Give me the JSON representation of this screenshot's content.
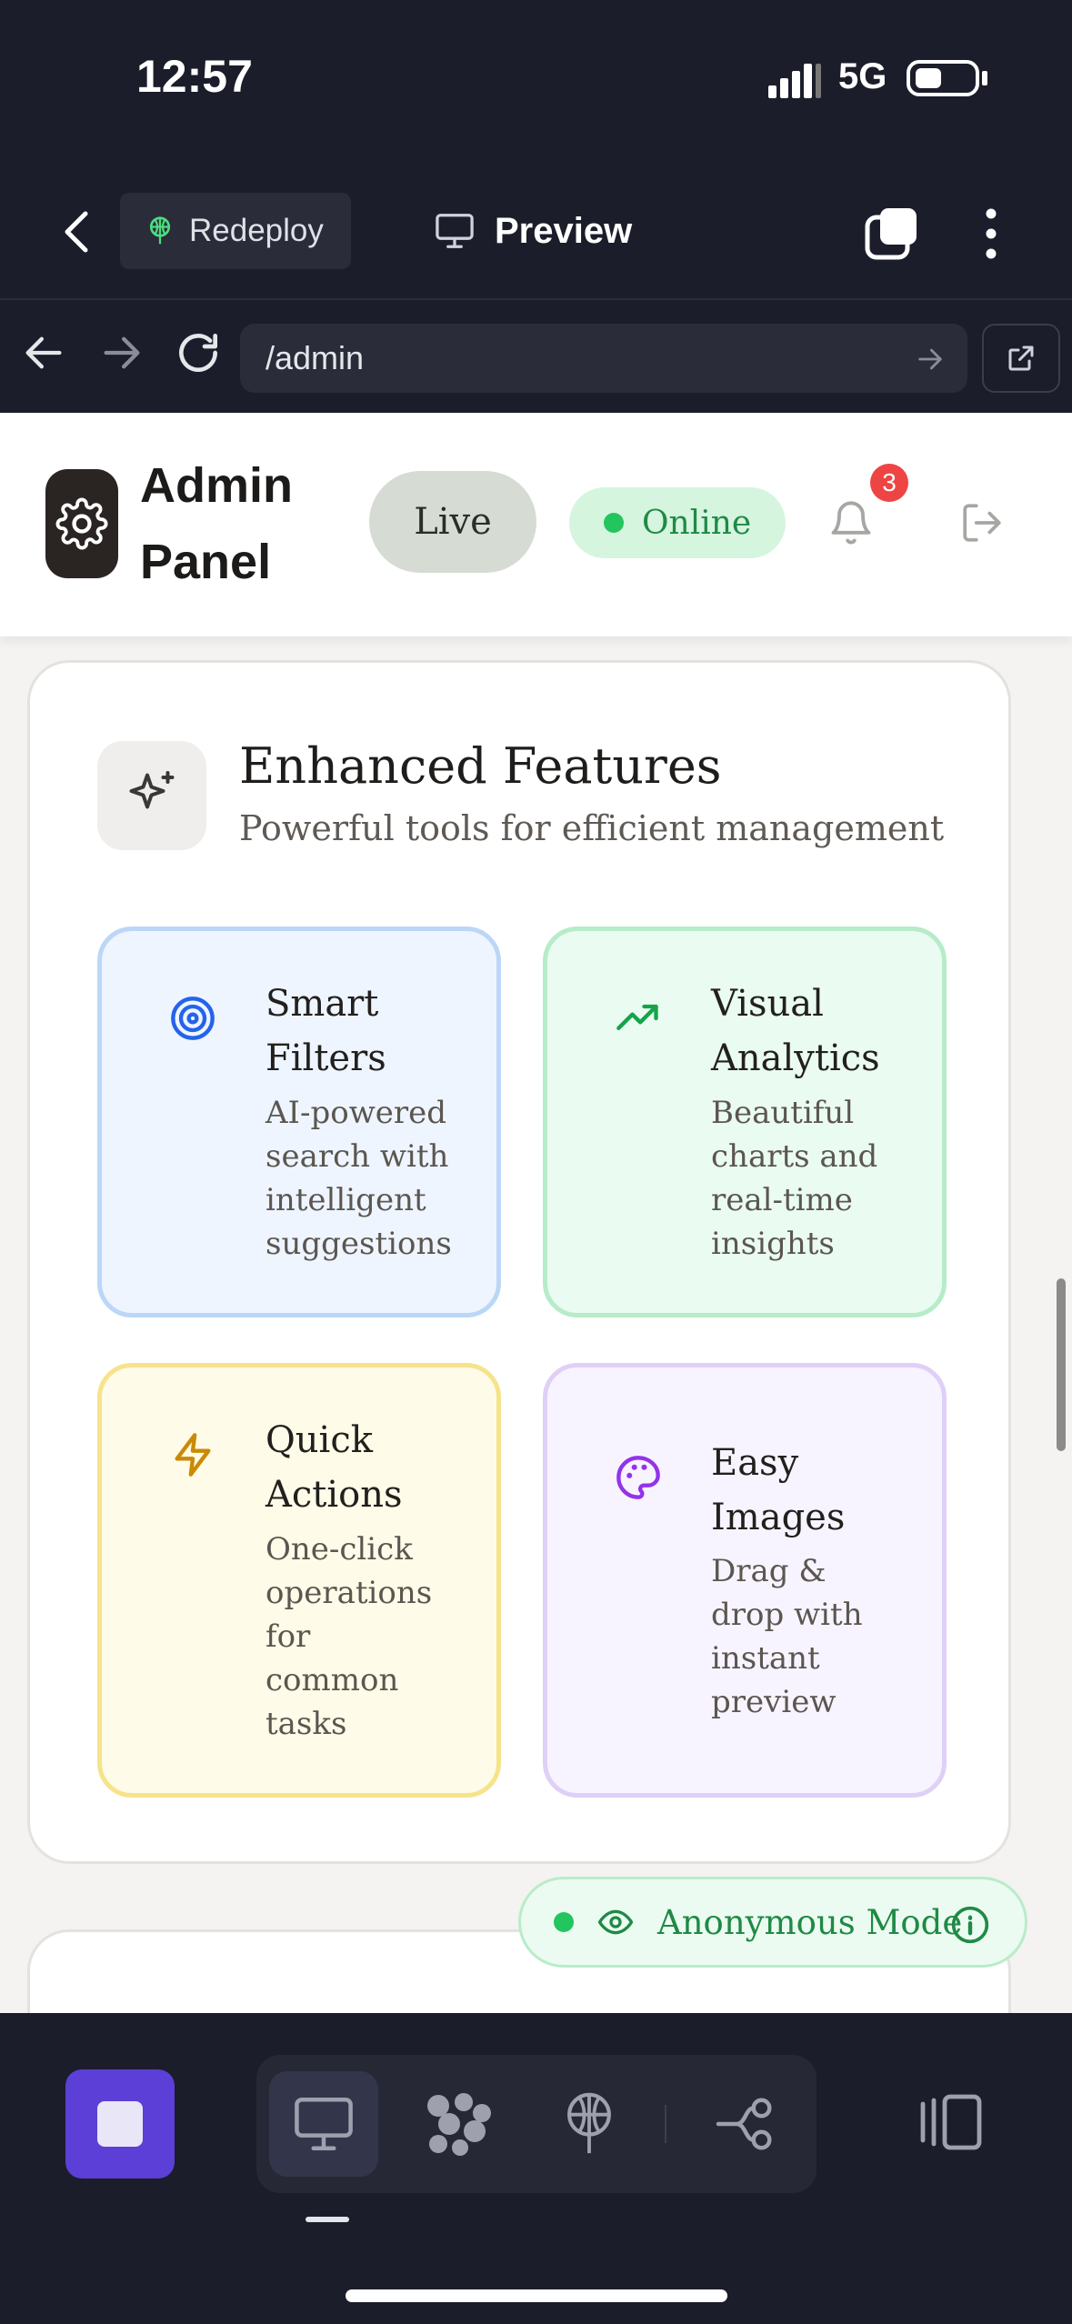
{
  "status_bar": {
    "time": "12:57",
    "network": "5G"
  },
  "toolbar": {
    "redeploy_label": "Redeploy",
    "preview_label": "Preview"
  },
  "url_bar": {
    "url": "/admin"
  },
  "admin_header": {
    "title": "Admin Panel",
    "live_label": "Live",
    "online_label": "Online",
    "notification_count": "3"
  },
  "features": {
    "title": "Enhanced Features",
    "subtitle": "Powerful tools for efficient management",
    "items": [
      {
        "title": "Smart Filters",
        "description": "AI-powered search with intelligent suggestions",
        "icon": "target-icon",
        "color": "#2563eb"
      },
      {
        "title": "Visual Analytics",
        "description": "Beautiful charts and real-time insights",
        "icon": "trending-up-icon",
        "color": "#16a34a"
      },
      {
        "title": "Quick Actions",
        "description": "One-click operations for common tasks",
        "icon": "zap-icon",
        "color": "#ca8a04"
      },
      {
        "title": "Easy Images",
        "description": "Drag & drop with instant preview",
        "icon": "palette-icon",
        "color": "#9333ea"
      }
    ]
  },
  "anonymous_badge": {
    "label": "Anonymous Mode"
  },
  "colors": {
    "dark_bg": "#1b1d2a",
    "accent_purple": "#5b3fd6",
    "online_green": "#22c55e",
    "badge_red": "#ef4444"
  }
}
